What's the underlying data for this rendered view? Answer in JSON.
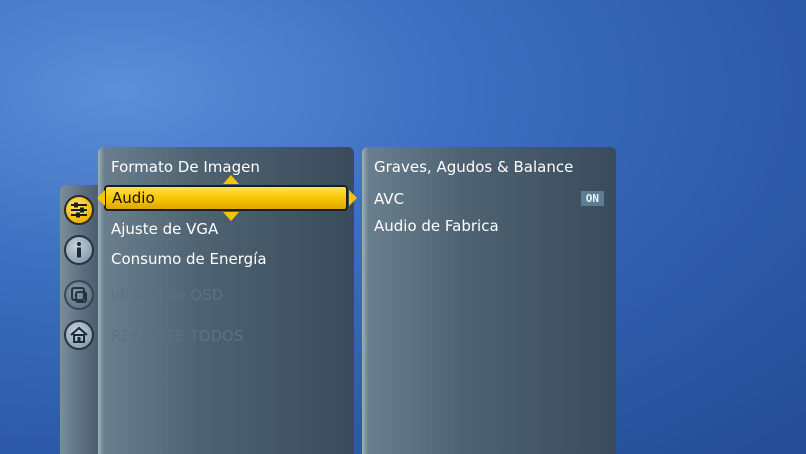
{
  "sidebar": {
    "icons": [
      {
        "name": "audio-settings-icon",
        "state": "active"
      },
      {
        "name": "info-icon",
        "state": "normal"
      },
      {
        "name": "osd-language-icon",
        "state": "dim"
      },
      {
        "name": "home-icon",
        "state": "normal"
      }
    ]
  },
  "main_menu": {
    "items": [
      {
        "label": "Formato De Imagen",
        "enabled": true
      },
      {
        "label": "Audio",
        "enabled": true,
        "selected": true
      },
      {
        "label": "Ajuste de VGA",
        "enabled": true
      },
      {
        "label": "Consumo de Energía",
        "enabled": true
      },
      {
        "label": "Idioma de OSD",
        "enabled": false
      },
      {
        "label": "REAJUSTE TODOS",
        "enabled": false
      }
    ]
  },
  "sub_menu": {
    "items": [
      {
        "label": "Graves, Agudos & Balance"
      },
      {
        "label": "AVC",
        "value": "ON"
      },
      {
        "label": "Audio de Fabrica"
      }
    ]
  },
  "colors": {
    "selection": "#f6c400",
    "disabled_text": "#5d7183"
  }
}
